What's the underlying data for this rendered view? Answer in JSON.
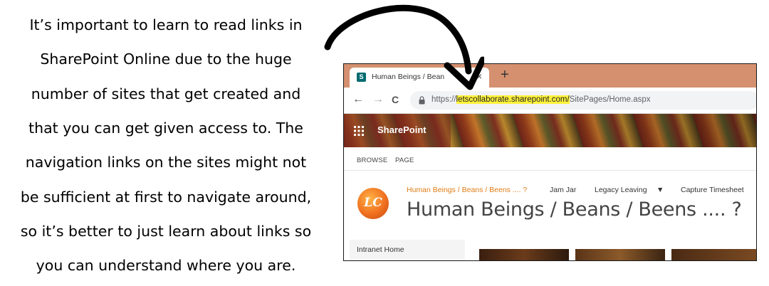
{
  "explanation_lines": [
    "It’s important to learn to read links in",
    "SharePoint Online due to the huge",
    "number of sites that get created and",
    "that you can get given access to.  The",
    "navigation links on the sites might not",
    "be sufficient at first to navigate around,",
    "so it’s better to just learn about links so",
    "you can understand where you are."
  ],
  "browser": {
    "tab_title": "Human Beings / Bean",
    "tab_close": "×",
    "new_tab": "+",
    "back": "←",
    "forward": "→",
    "reload": "C",
    "url_prefix": "https://",
    "url_host": "letscollaborate.sharepoint.com/",
    "url_path": "SitePages/Home.aspx",
    "favicon_letter": "S"
  },
  "suite_bar": {
    "app_name": "SharePoint"
  },
  "ribbon": {
    "tabs": [
      "BROWSE",
      "PAGE"
    ]
  },
  "site": {
    "logo_text": "LC",
    "nav": {
      "current_site": "Human Beings / Beans / Beens .... ?",
      "items": [
        "Jam Jar",
        "Legacy Leaving",
        "Capture Timesheet"
      ],
      "dropdown_caret": "▼"
    },
    "title": "Human Beings / Beans / Beens .... ?"
  },
  "quick_launch": {
    "first_item": "Intranet Home"
  },
  "colors": {
    "tab_bar": "#d4906f",
    "url_highlight": "#fff23b",
    "site_link": "#e07b14",
    "favicon": "#036c70"
  }
}
